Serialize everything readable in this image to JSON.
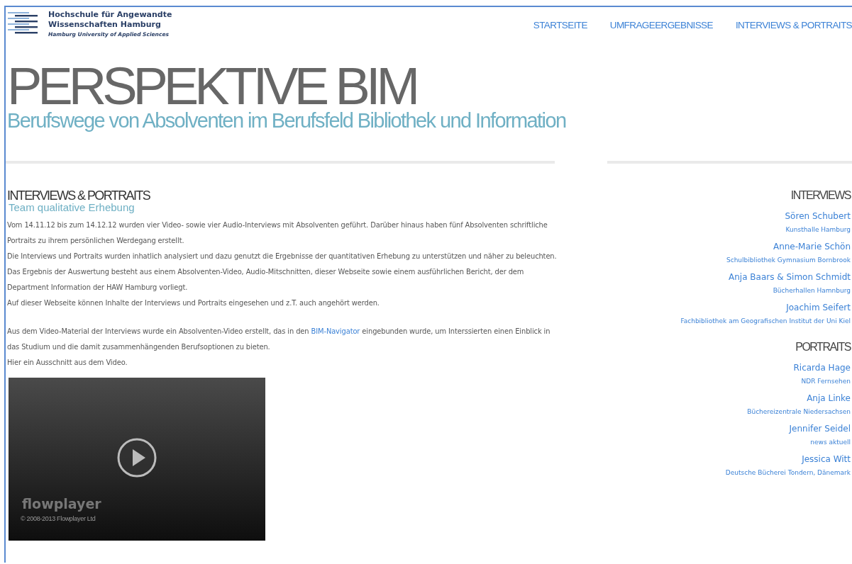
{
  "logo": {
    "lines": [
      "Hochschule für Angewandte",
      "Wissenschaften Hamburg"
    ],
    "subline": "Hamburg University of Applied Sciences"
  },
  "nav": [
    "STARTSEITE",
    "UMFRAGEERGEBNISSE",
    "INTERVIEWS & PORTRAITS"
  ],
  "title": "PERSPEKTIVE BIM",
  "subtitle": "Berufswege von Absolventen im Berufsfeld Bibliothek und Information",
  "main": {
    "heading": "INTERVIEWS & PORTRAITS",
    "subheading": "Team qualitative Erhebung",
    "blocks": [
      {
        "paragraphs": [
          [
            {
              "kind": "text",
              "text": "Vom 14.11.12 bis zum 14.12.12 wurden vier Video- sowie vier Audio-Interviews mit Absolventen geführt. Darüber hinaus haben fünf Absolventen schriftliche Portraits zu ihrem persönlichen Werdegang erstellt."
            }
          ],
          [
            {
              "kind": "text",
              "text": "Die Interviews und Portraits wurden inhatlich analysiert und dazu genutzt die Ergebnisse der quantitativen Erhebung zu unterstützen und näher zu beleuchten."
            }
          ],
          [
            {
              "kind": "text",
              "text": "Das Ergebnis der Auswertung besteht aus einem Absolventen-Video, Audio-Mitschnitten, dieser Webseite sowie einem ausführlichen Bericht, der dem Department Information der HAW Hamburg vorliegt."
            }
          ],
          [
            {
              "kind": "text",
              "text": "Auf dieser Webseite können Inhalte der Interviews und Portraits eingesehen und z.T. auch angehört werden."
            }
          ]
        ]
      },
      {
        "paragraphs": [
          [
            {
              "kind": "text",
              "text": "Aus dem Video-Material der Interviews wurde ein Absolventen-Video erstellt, das in den "
            },
            {
              "kind": "link",
              "text": "BIM-Navigator"
            },
            {
              "kind": "text",
              "text": " eingebunden wurde, um Interssierten einen Einblick in das Studium und die damit zusammenhängenden Berufsoptionen zu bieten."
            }
          ],
          [
            {
              "kind": "text",
              "text": "Hier ein Ausschnitt aus dem Video."
            }
          ]
        ]
      }
    ],
    "video": {
      "brand": "flowplayer",
      "copyright": "© 2008-2013 Flowplayer Ltd"
    }
  },
  "sidebar": [
    {
      "heading": "INTERVIEWS",
      "items": [
        {
          "name": "Sören Schubert",
          "place": "Kunsthalle Hamburg"
        },
        {
          "name": "Anne-Marie Schön",
          "place": "Schulbibliothek Gymnasium Bornbrook"
        },
        {
          "name": "Anja Baars & Simon Schmidt",
          "place": "Bücherhallen Hamnburg"
        },
        {
          "name": "Joachim Seifert",
          "place": "Fachbibliothek am Geografischen Institut der Uni Kiel"
        }
      ]
    },
    {
      "heading": "PORTRAITS",
      "items": [
        {
          "name": "Ricarda Hage",
          "place": "NDR Fernsehen"
        },
        {
          "name": "Anja Linke",
          "place": "Büchereizentrale Niedersachsen"
        },
        {
          "name": "Jennifer Seidel",
          "place": "news aktuell"
        },
        {
          "name": "Jessica Witt",
          "place": "Deutsche Bücherei Tondern, Dänemark"
        }
      ]
    }
  ]
}
